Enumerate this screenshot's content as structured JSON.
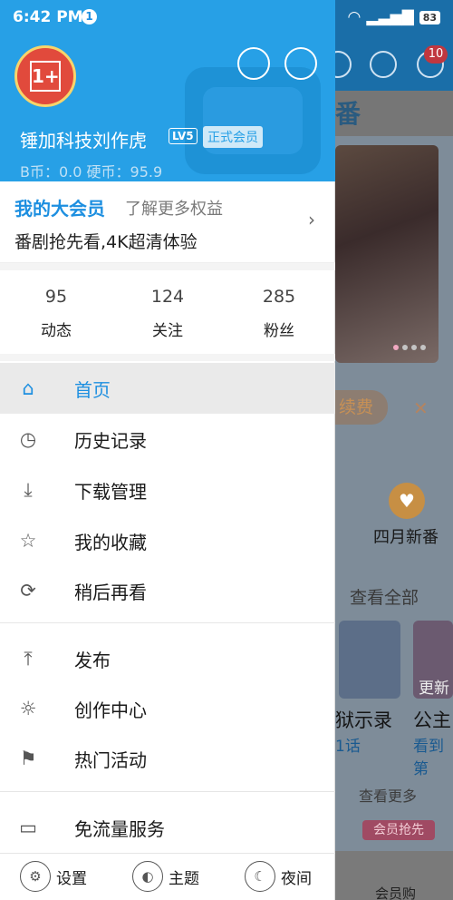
{
  "status_bar": {
    "time": "6:42 PM",
    "notif_count": "1",
    "battery": "83"
  },
  "header": {
    "username": "锤加科技刘作虎",
    "level": "LV5",
    "member": "正式会员",
    "coins": "B币：0.0   硬币：95.9",
    "avatar_text": "1+"
  },
  "vip": {
    "title": "我的大会员",
    "more": "了解更多权益",
    "desc": "番剧抢先看,4K超清体验"
  },
  "stats": [
    {
      "num": "95",
      "label": "动态"
    },
    {
      "num": "124",
      "label": "关注"
    },
    {
      "num": "285",
      "label": "粉丝"
    }
  ],
  "menu": [
    {
      "label": "首页",
      "icon": "home-icon"
    },
    {
      "label": "历史记录",
      "icon": "history-icon"
    },
    {
      "label": "下载管理",
      "icon": "download-icon"
    },
    {
      "label": "我的收藏",
      "icon": "star-icon"
    },
    {
      "label": "稍后再看",
      "icon": "watch-later-icon"
    },
    {
      "label": "发布",
      "icon": "upload-icon"
    },
    {
      "label": "创作中心",
      "icon": "bulb-icon"
    },
    {
      "label": "热门活动",
      "icon": "flag-icon"
    },
    {
      "label": "免流量服务",
      "icon": "sim-icon"
    }
  ],
  "bottom": [
    {
      "label": "设置",
      "icon": "settings-icon"
    },
    {
      "label": "主题",
      "icon": "palette-icon"
    },
    {
      "label": "夜间",
      "icon": "moon-icon"
    }
  ],
  "background": {
    "section_title": "番",
    "renew": "续费",
    "new_anime": "四月新番",
    "see_all": "查看全部",
    "update": "更新",
    "card1_title": "狱示录",
    "card1_sub": "1话",
    "card2_title": "公主",
    "card2_sub": "看到第",
    "see_more": "查看更多",
    "promo": "会员抢先",
    "shop": "会员购",
    "msg_badge": "10"
  },
  "colors": {
    "accent": "#1d8fe0",
    "header_bg": "#27a0e6"
  }
}
